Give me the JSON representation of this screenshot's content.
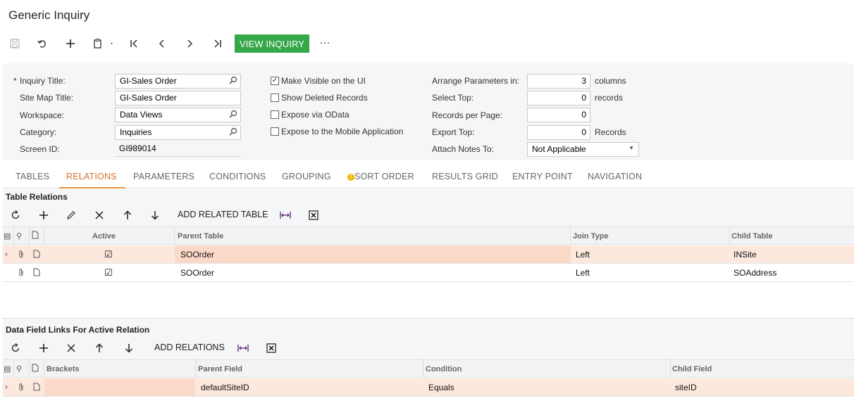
{
  "page": {
    "title": "Generic Inquiry"
  },
  "toolbar": {
    "view_inquiry_label": "VIEW INQUIRY",
    "more_label": "···"
  },
  "form": {
    "inquiry_title_label": "Inquiry Title:",
    "inquiry_title_value": "GI-Sales Order",
    "site_map_title_label": "Site Map Title:",
    "site_map_title_value": "GI-Sales Order",
    "workspace_label": "Workspace:",
    "workspace_value": "Data Views",
    "category_label": "Category:",
    "category_value": "Inquiries",
    "screen_id_label": "Screen ID:",
    "screen_id_value": "GI989014",
    "make_visible_label": "Make Visible on the UI",
    "make_visible_checked": true,
    "show_deleted_label": "Show Deleted Records",
    "show_deleted_checked": false,
    "expose_odata_label": "Expose via OData",
    "expose_odata_checked": false,
    "expose_mobile_label": "Expose to the Mobile Application",
    "expose_mobile_checked": false,
    "arrange_label": "Arrange Parameters in:",
    "arrange_value": "3",
    "arrange_unit": "columns",
    "select_top_label": "Select Top:",
    "select_top_value": "0",
    "select_top_unit": "records",
    "records_per_page_label": "Records per Page:",
    "records_per_page_value": "0",
    "export_top_label": "Export Top:",
    "export_top_value": "0",
    "export_top_unit": "Records",
    "attach_notes_label": "Attach Notes To:",
    "attach_notes_value": "Not Applicable"
  },
  "tabs": [
    {
      "label": "TABLES"
    },
    {
      "label": "RELATIONS",
      "active": true
    },
    {
      "label": "PARAMETERS"
    },
    {
      "label": "CONDITIONS"
    },
    {
      "label": "GROUPING"
    },
    {
      "label": "SORT ORDER",
      "warning": true
    },
    {
      "label": "RESULTS GRID"
    },
    {
      "label": "ENTRY POINT"
    },
    {
      "label": "NAVIGATION"
    }
  ],
  "table_relations": {
    "title": "Table Relations",
    "add_label": "ADD RELATED TABLE",
    "columns": {
      "active": "Active",
      "parent_table": "Parent Table",
      "join_type": "Join Type",
      "child_table": "Child Table"
    },
    "rows": [
      {
        "active": "☑",
        "parent_table": "SOOrder",
        "join_type": "Left",
        "child_table": "INSite",
        "selected": true
      },
      {
        "active": "☑",
        "parent_table": "SOOrder",
        "join_type": "Left",
        "child_table": "SOAddress",
        "selected": false
      }
    ]
  },
  "data_field_links": {
    "title": "Data Field Links For Active Relation",
    "add_label": "ADD RELATIONS",
    "columns": {
      "brackets": "Brackets",
      "parent_field": "Parent Field",
      "condition": "Condition",
      "child_field": "Child Field"
    },
    "rows": [
      {
        "brackets": "",
        "parent_field": "defaultSiteID",
        "condition": "Equals",
        "child_field": "siteID"
      }
    ]
  }
}
